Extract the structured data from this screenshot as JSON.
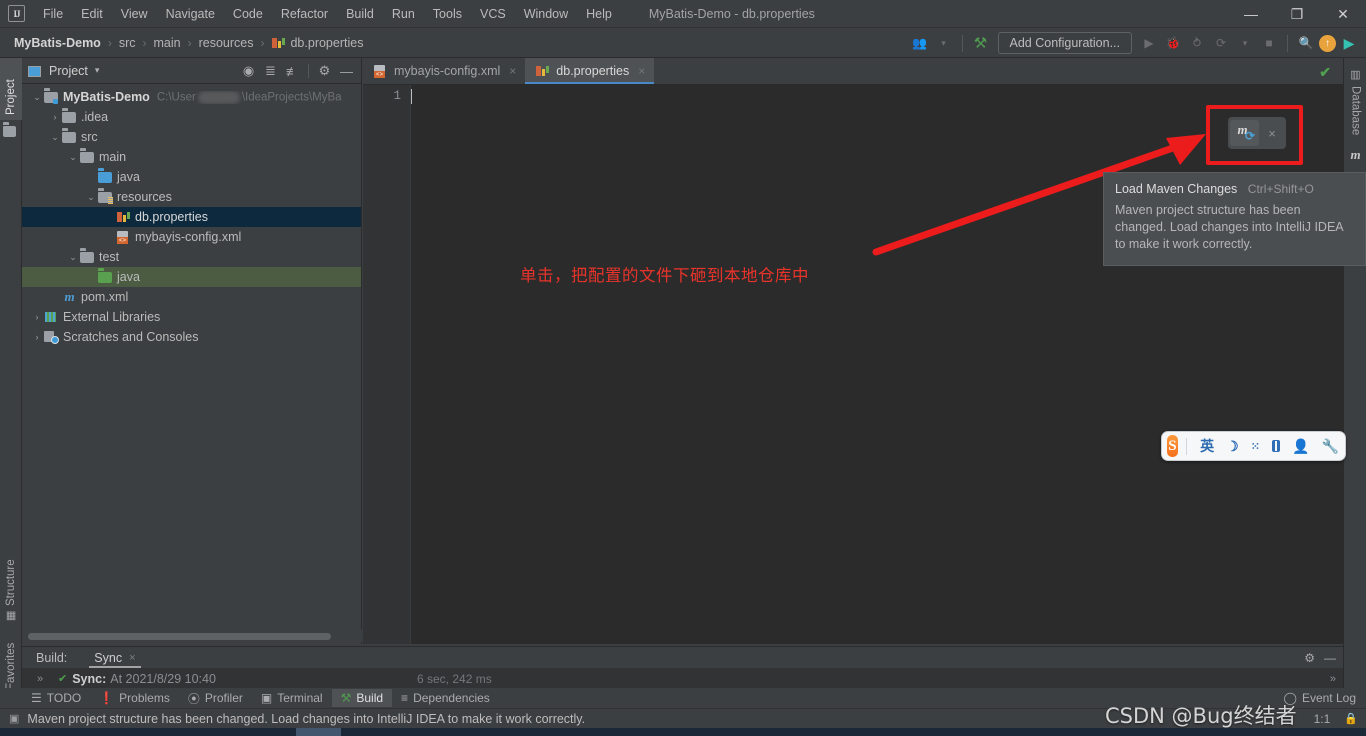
{
  "window": {
    "title": "MyBatis-Demo - db.properties",
    "logo": "IJ",
    "controls": {
      "minimize": "—",
      "maximize": "❐",
      "close": "✕"
    }
  },
  "menubar": {
    "items": [
      "File",
      "Edit",
      "View",
      "Navigate",
      "Code",
      "Refactor",
      "Build",
      "Run",
      "Tools",
      "VCS",
      "Window",
      "Help"
    ]
  },
  "breadcrumb": {
    "items": [
      "MyBatis-Demo",
      "src",
      "main",
      "resources",
      "db.properties"
    ],
    "separator": "›"
  },
  "toolbar": {
    "vcs_icon": "👥",
    "hammer_icon": "⚒",
    "run_config": "Add Configuration...",
    "run_icon": "▶",
    "debug_icon": "🐞",
    "coverage_icon": "⥁",
    "profile_icon": "⟳",
    "dropdown_icon": "▾",
    "stop_icon": "■",
    "search_icon": "🔍",
    "updates_icon": "↑",
    "idea_icon": "▶"
  },
  "left_strip": {
    "project": "Project",
    "structure": "Structure",
    "favorites": "Favorites"
  },
  "right_strip": {
    "database": "Database",
    "maven": "m"
  },
  "project_panel": {
    "title": "Project",
    "caret": "▾",
    "icons": [
      "locate-icon",
      "expand-icon",
      "collapse-icon",
      "settings-icon",
      "hide-icon"
    ],
    "tree": [
      {
        "depth": 0,
        "arrow": "⌄",
        "icon": "folder-module",
        "label": "MyBatis-Demo",
        "bold": true,
        "path_prefix": "C:\\User",
        "path_suffix": "\\IdeaProjects\\MyBa",
        "blurred": true
      },
      {
        "depth": 1,
        "arrow": "›",
        "icon": "folder",
        "label": ".idea"
      },
      {
        "depth": 1,
        "arrow": "⌄",
        "icon": "folder",
        "label": "src"
      },
      {
        "depth": 2,
        "arrow": "⌄",
        "icon": "folder",
        "label": "main"
      },
      {
        "depth": 3,
        "arrow": "",
        "icon": "folder-source",
        "label": "java"
      },
      {
        "depth": 3,
        "arrow": "⌄",
        "icon": "folder-resources",
        "label": "resources"
      },
      {
        "depth": 4,
        "arrow": "",
        "icon": "properties-file",
        "label": "db.properties",
        "selected": true
      },
      {
        "depth": 4,
        "arrow": "",
        "icon": "xml-file",
        "label": "mybayis-config.xml"
      },
      {
        "depth": 2,
        "arrow": "⌄",
        "icon": "folder",
        "label": "test"
      },
      {
        "depth": 3,
        "arrow": "",
        "icon": "folder-test",
        "label": "java",
        "selected_green": true
      },
      {
        "depth": 1,
        "arrow": "",
        "icon": "maven-file",
        "label": "pom.xml"
      },
      {
        "depth": 0,
        "arrow": "›",
        "icon": "libraries",
        "label": "External Libraries"
      },
      {
        "depth": 0,
        "arrow": "›",
        "icon": "scratches",
        "label": "Scratches and Consoles"
      }
    ]
  },
  "editor": {
    "tabs": [
      {
        "label": "mybayis-config.xml",
        "icon": "xml-file",
        "active": false,
        "close": "×"
      },
      {
        "label": "db.properties",
        "icon": "properties-file",
        "active": true,
        "close": "×"
      }
    ],
    "line_number": "1",
    "inspection_status": "✔"
  },
  "maven_popup": {
    "button_icon": "m",
    "refresh_icon": "⟳",
    "close_icon": "×"
  },
  "tooltip": {
    "title": "Load Maven Changes",
    "shortcut": "Ctrl+Shift+O",
    "body": "Maven project structure has been changed. Load changes into IntelliJ IDEA to make it work correctly."
  },
  "annotation": {
    "text": "单击，把配置的文件下砸到本地仓库中",
    "color": "#e8332a"
  },
  "ime": {
    "logo": "S",
    "mode": "英",
    "moon_icon": "☽",
    "dots_icon": "⁙",
    "keyboard_icon": "keyboard-icon",
    "user_icon": "👤",
    "tools_icon": "🔧"
  },
  "build_panel": {
    "label": "Build:",
    "tab": "Sync",
    "tab_close": "×",
    "chevron": "»",
    "status_icon": "✔",
    "status_name": "Sync:",
    "status_when": "At 2021/8/29 10:40",
    "duration": "6 sec, 242 ms",
    "settings_icon": "⚙",
    "hide_icon": "—",
    "right_chevron": "»"
  },
  "bottom_bar": {
    "items": [
      {
        "label": "TODO",
        "icon": "☰",
        "active": false
      },
      {
        "label": "Problems",
        "icon": "❗",
        "active": false
      },
      {
        "label": "Profiler",
        "icon": "⦿",
        "active": false
      },
      {
        "label": "Terminal",
        "icon": "▣",
        "active": false
      },
      {
        "label": "Build",
        "icon": "⚒",
        "active": true
      },
      {
        "label": "Dependencies",
        "icon": "≡",
        "active": false
      }
    ],
    "event_log": "Event Log",
    "event_log_icon": "◯"
  },
  "status_bar": {
    "message_icon": "▣",
    "message": "Maven project structure has been changed. Load changes into IntelliJ IDEA to make it work correctly.",
    "caret_position": "1:1",
    "lock_icon": "🔒"
  },
  "watermark": "CSDN @Bug终结者",
  "colors": {
    "bg": "#3c3f41",
    "editor_bg": "#2b2b2b",
    "accent": "#4a88c7",
    "selection": "#0d293e",
    "selection_green": "#4b5c43",
    "annotation_red": "#e8332a",
    "ok_green": "#4f9f4f"
  }
}
